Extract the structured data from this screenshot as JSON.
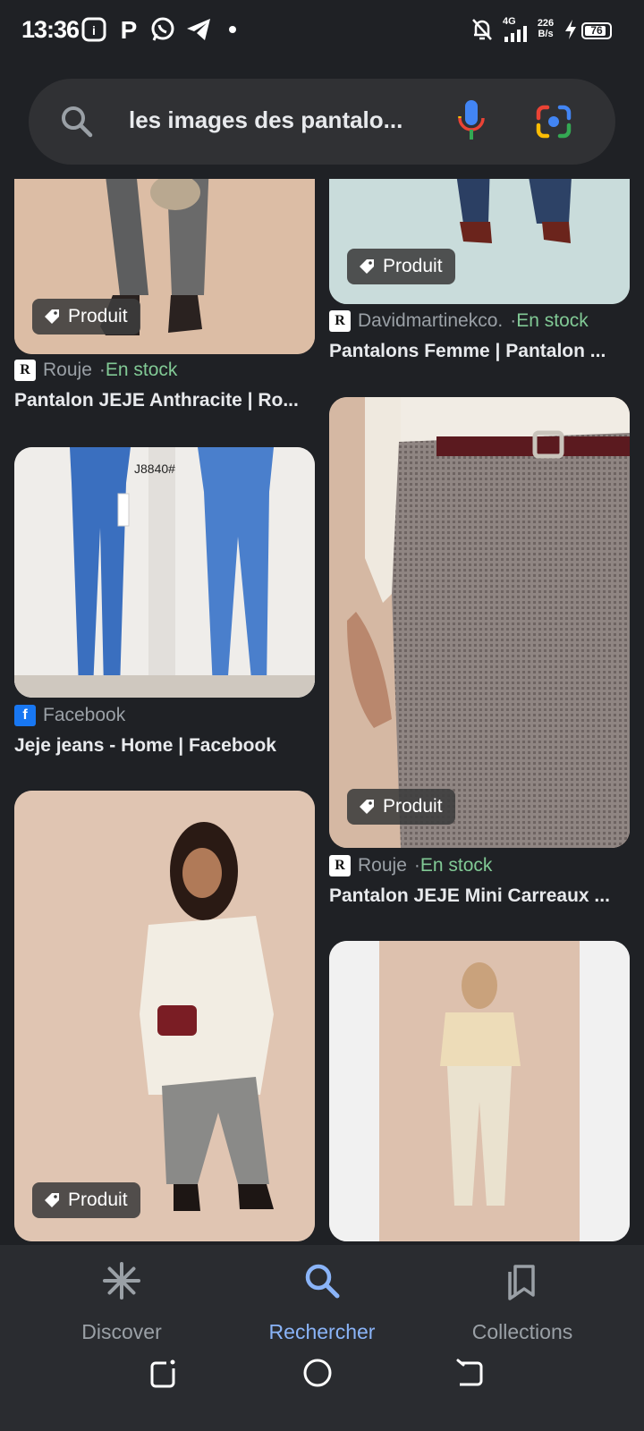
{
  "status_bar": {
    "time": "13:36",
    "network_type": "4G",
    "speed_value": "226",
    "speed_unit": "B/s",
    "battery_level": "76"
  },
  "search": {
    "query": "les images des pantalo..."
  },
  "results": [
    {
      "badge": "Produit",
      "source": "Rouje",
      "separator": " · ",
      "stock": "En stock",
      "title": "Pantalon JEJE Anthracite | Ro..."
    },
    {
      "badge": "Produit",
      "source": "Davidmartinekco.",
      "separator": " · ",
      "stock": "En stock",
      "title": "Pantalons Femme | Pantalon ..."
    },
    {
      "image_text": "J8840#",
      "source": "Facebook",
      "title": "Jeje jeans - Home | Facebook"
    },
    {
      "badge": "Produit",
      "source": "Rouje",
      "separator": " · ",
      "stock": "En stock",
      "title": "Pantalon JEJE Mini Carreaux ..."
    },
    {
      "badge": "Produit"
    },
    {}
  ],
  "bottom_nav": {
    "items": [
      {
        "label": "Discover",
        "icon": "asterisk-icon"
      },
      {
        "label": "Rechercher",
        "icon": "search-icon"
      },
      {
        "label": "Collections",
        "icon": "collections-icon"
      }
    ],
    "active_index": 1
  },
  "system_nav": [
    "recents-icon",
    "home-icon",
    "back-icon"
  ],
  "colors": {
    "background": "#1f2125",
    "searchbar": "#303134",
    "accent": "#8ab4f8",
    "stock_green": "#81c995",
    "muted": "#9aa0a6"
  }
}
